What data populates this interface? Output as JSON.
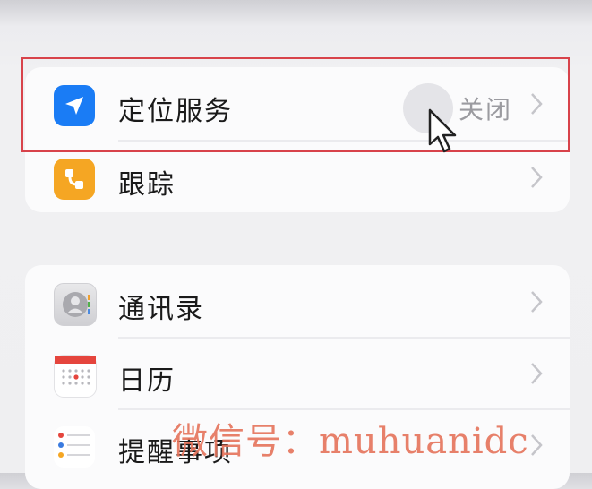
{
  "card1": {
    "items": [
      {
        "label": "定位服务",
        "value": "关闭",
        "icon": "location-arrow-icon",
        "icon_color": "#1a7cf5"
      },
      {
        "label": "跟踪",
        "value": "",
        "icon": "tracking-icon",
        "icon_color": "#f5a623"
      }
    ]
  },
  "card2": {
    "items": [
      {
        "label": "通讯录",
        "icon": "contacts-icon"
      },
      {
        "label": "日历",
        "icon": "calendar-icon"
      },
      {
        "label": "提醒事项",
        "icon": "reminders-icon"
      }
    ]
  },
  "watermark": "微信号：muhuanidc",
  "colors": {
    "highlight": "#d8434b",
    "accent": "#1a7cf5",
    "background": "#f0f0f2"
  }
}
